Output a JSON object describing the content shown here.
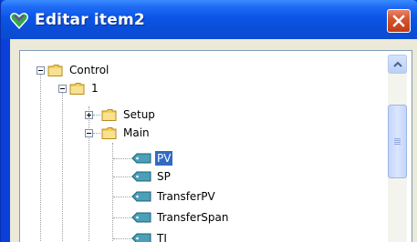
{
  "window": {
    "title": "Editar item2",
    "title_icon": "heart-badge-icon",
    "close_icon": "close-icon",
    "colors": {
      "titlebar": "#0b55e6",
      "close": "#d6552f",
      "selection": "#316ac5"
    }
  },
  "tree": {
    "nodes": [
      {
        "label": "Control",
        "type": "folder",
        "expanded": true
      },
      {
        "label": "1",
        "type": "folder",
        "expanded": true
      },
      {
        "label": "Setup",
        "type": "folder",
        "expanded": false
      },
      {
        "label": "Main",
        "type": "folder",
        "expanded": true
      },
      {
        "label": "PV",
        "type": "tag",
        "selected": true
      },
      {
        "label": "SP",
        "type": "tag"
      },
      {
        "label": "TransferPV",
        "type": "tag"
      },
      {
        "label": "TransferSpan",
        "type": "tag"
      },
      {
        "label": "TI",
        "type": "tag"
      }
    ]
  },
  "scrollbar": {
    "up_icon": "chevron-up-icon",
    "position": 0.25
  }
}
